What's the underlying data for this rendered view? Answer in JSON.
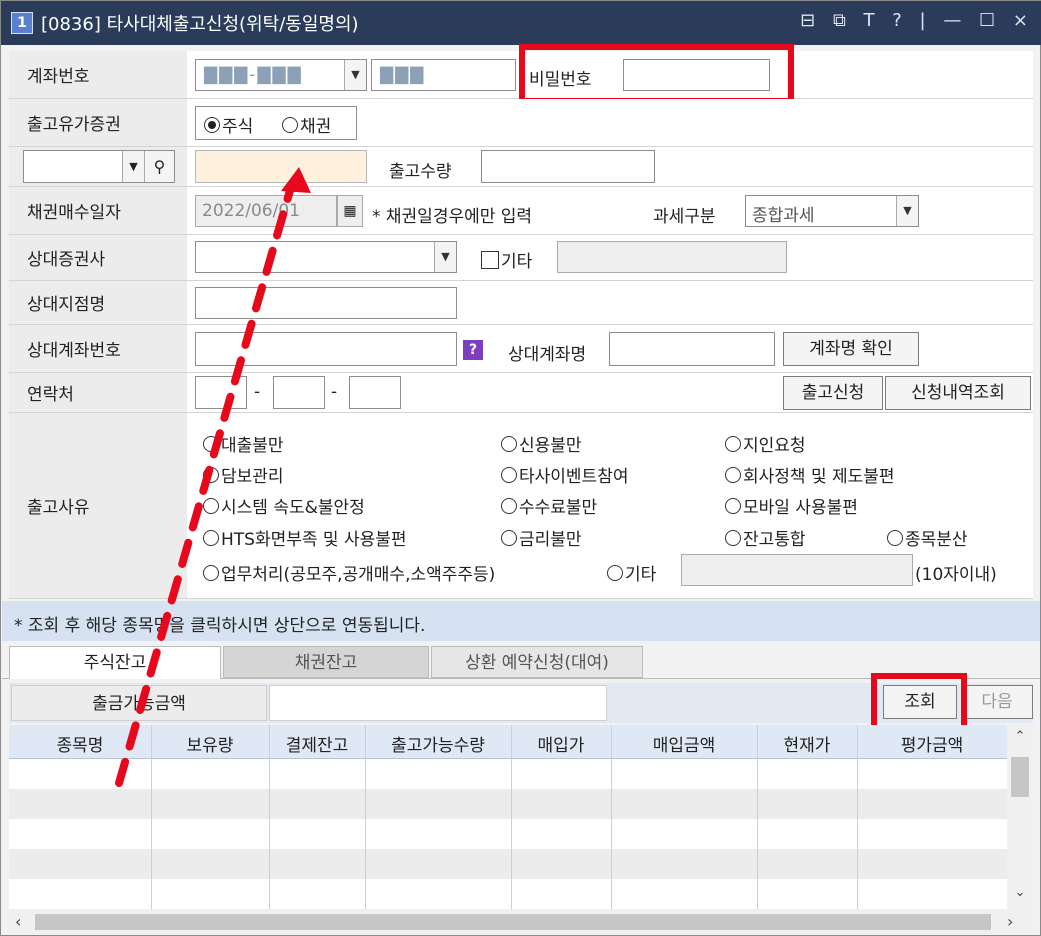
{
  "window": {
    "number": "1",
    "title": "[0836] 타사대체출고신청(위탁/동일명의)",
    "controls": "⊟ ⧉ T ? | — ☐ ×"
  },
  "form": {
    "account_label": "계좌번호",
    "account_value": "▇▇▇-▇▇▇",
    "account_name_value": "▇▇▇",
    "password_label": "비밀번호",
    "security_type_label": "출고유가증권",
    "stock_option": "주식",
    "bond_option": "채권",
    "quantity_label": "출고수량",
    "bond_date_label": "채권매수일자",
    "bond_date_value": "2022/06/01",
    "bond_date_note": "* 채권일경우에만 입력",
    "tax_label": "과세구분",
    "tax_value": "종합과세",
    "counter_firm_label": "상대증권사",
    "other_label": "기타",
    "counter_branch_label": "상대지점명",
    "counter_account_label": "상대계좌번호",
    "help_icon": "?",
    "counter_account_name_label": "상대계좌명",
    "confirm_name_button": "계좌명 확인",
    "contact_label": "연락처",
    "dash1": "-",
    "dash2": "-",
    "request_button": "출고신청",
    "history_button": "신청내역조회",
    "reason_label": "출고사유",
    "reasons": [
      "대출불만",
      "신용불만",
      "지인요청",
      "담보관리",
      "타사이벤트참여",
      "회사정책 및 제도불편",
      "시스템 속도&불안정",
      "수수료불만",
      "모바일 사용불편",
      "HTS화면부족 및 사용불편",
      "금리불만",
      "잔고통합",
      "종목분산",
      "업무처리(공모주,공개매수,소액주주등)",
      "기타"
    ],
    "reason_other_limit": "(10자이내)"
  },
  "notice": "* 조회 후 해당 종목명을 클릭하시면 상단으로 연동됩니다.",
  "tabs": [
    "주식잔고",
    "채권잔고",
    "상환 예약신청(대여)"
  ],
  "balance": {
    "available_amount_label": "출금가능금액",
    "query_button": "조회",
    "next_button": "다음",
    "columns": [
      "종목명",
      "보유량",
      "결제잔고",
      "출고가능수량",
      "매입가",
      "매입금액",
      "현재가",
      "평가금액"
    ]
  },
  "colors": {
    "titlebar": "#2a3c5a",
    "highlight": "#e8081b",
    "input_highlight": "#fdf0dd",
    "header_bg": "#dfe8f5",
    "notice_bg": "#d6e2f2"
  }
}
